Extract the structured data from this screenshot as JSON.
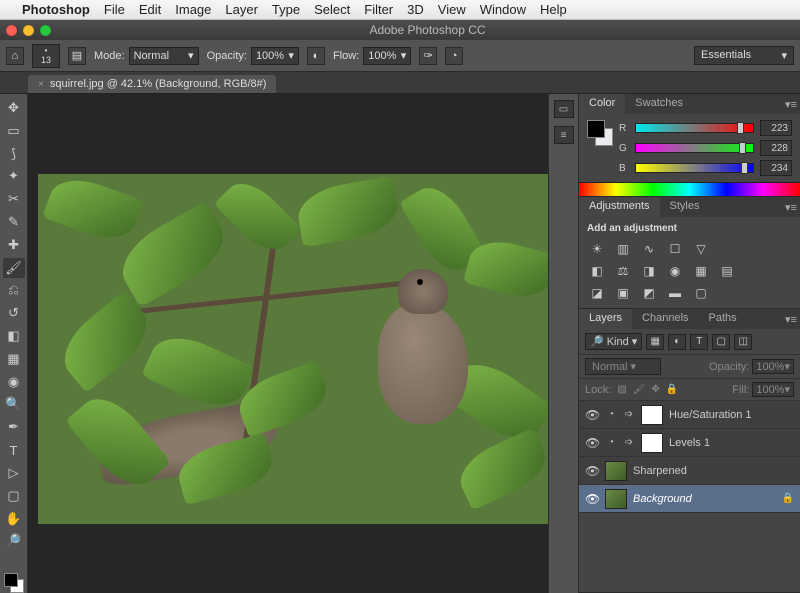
{
  "menubar": {
    "app": "Photoshop",
    "items": [
      "File",
      "Edit",
      "Image",
      "Layer",
      "Type",
      "Select",
      "Filter",
      "3D",
      "View",
      "Window",
      "Help"
    ]
  },
  "window": {
    "title": "Adobe Photoshop CC"
  },
  "options": {
    "brush_size": "13",
    "mode_label": "Mode:",
    "mode_value": "Normal",
    "opacity_label": "Opacity:",
    "opacity_value": "100%",
    "flow_label": "Flow:",
    "flow_value": "100%",
    "workspace": "Essentials"
  },
  "document": {
    "tab_label": "squirrel.jpg @ 42.1% (Background, RGB/8#)"
  },
  "color_panel": {
    "tabs": [
      "Color",
      "Swatches"
    ],
    "r_label": "R",
    "g_label": "G",
    "b_label": "B",
    "r": "223",
    "g": "228",
    "b": "234"
  },
  "adjustments_panel": {
    "tabs": [
      "Adjustments",
      "Styles"
    ],
    "heading": "Add an adjustment"
  },
  "layers_panel": {
    "tabs": [
      "Layers",
      "Channels",
      "Paths"
    ],
    "kind_label": "Kind",
    "blend_mode": "Normal",
    "opacity_label": "Opacity:",
    "opacity_value": "100%",
    "lock_label": "Lock:",
    "fill_label": "Fill:",
    "fill_value": "100%",
    "layers": [
      {
        "name": "Hue/Saturation 1",
        "adjustment": true
      },
      {
        "name": "Levels 1",
        "adjustment": true
      },
      {
        "name": "Sharpened",
        "image": true
      },
      {
        "name": "Background",
        "image": true,
        "locked": true,
        "selected": true,
        "italic": true
      }
    ]
  }
}
